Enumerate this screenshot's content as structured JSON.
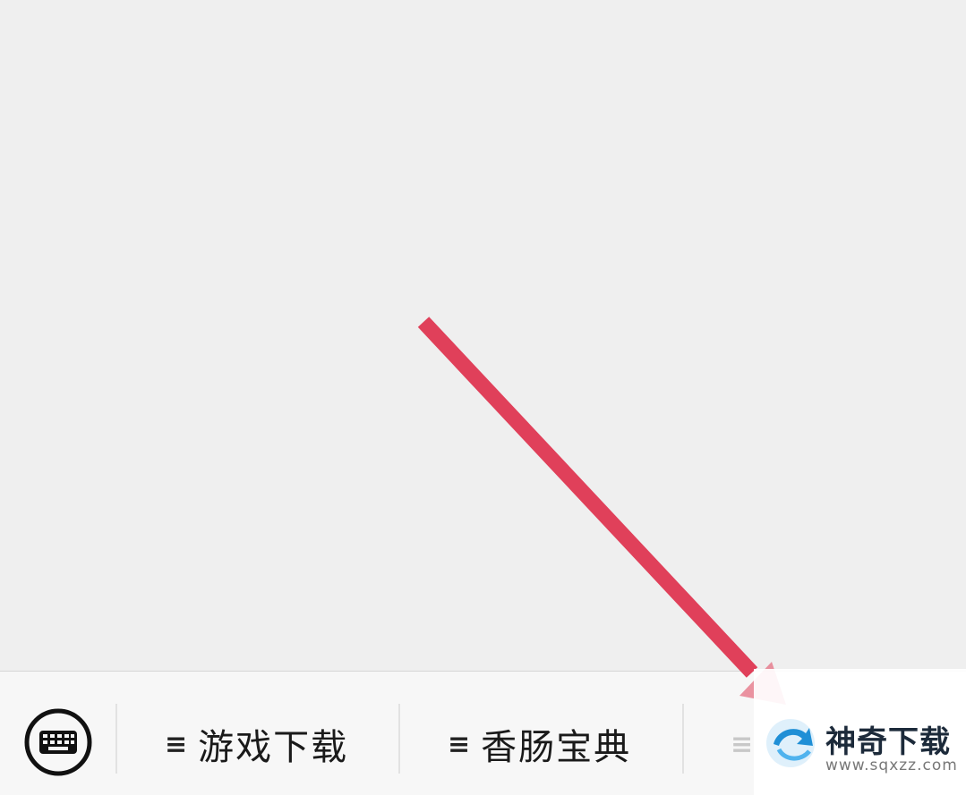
{
  "menu_bar": {
    "keyboard_icon": "keyboard-icon",
    "items": [
      {
        "glyph": "≡",
        "label": "游戏下载"
      },
      {
        "glyph": "≡",
        "label": "香肠宝典"
      },
      {
        "glyph": "≡",
        "label": ""
      }
    ]
  },
  "annotation": {
    "color": "#e0405a"
  },
  "watermark": {
    "title": "神奇下载",
    "url": "www.sqxzz.com",
    "logo_icon": "blue-arrow-logo-icon"
  }
}
